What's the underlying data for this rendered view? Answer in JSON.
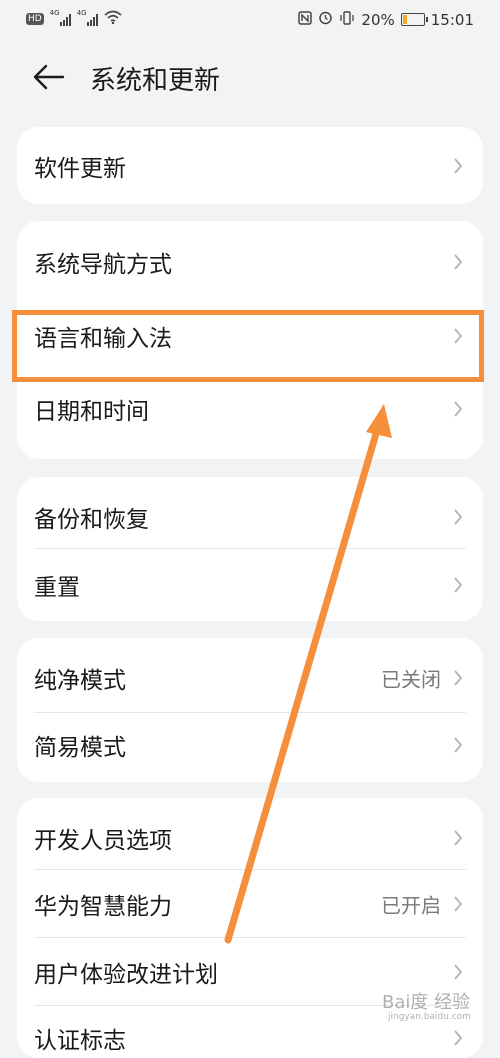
{
  "status_bar": {
    "hd": "HD",
    "sim1_network": "4G",
    "sim2_network": "4G",
    "battery_percent": "20%",
    "battery_level": 0.2,
    "time": "15:01",
    "icons": [
      "nfc-icon",
      "alarm-icon",
      "vibrate-icon",
      "wifi-icon"
    ]
  },
  "header": {
    "title": "系统和更新",
    "back_icon": "back-arrow-icon"
  },
  "sections": [
    {
      "items": [
        {
          "label": "软件更新"
        }
      ]
    },
    {
      "items": [
        {
          "label": "系统导航方式"
        },
        {
          "label": "语言和输入法",
          "highlighted": true
        },
        {
          "label": "日期和时间"
        }
      ]
    },
    {
      "items": [
        {
          "label": "备份和恢复"
        },
        {
          "label": "重置"
        }
      ]
    },
    {
      "items": [
        {
          "label": "纯净模式",
          "value": "已关闭"
        },
        {
          "label": "简易模式"
        }
      ]
    },
    {
      "items": [
        {
          "label": "开发人员选项"
        },
        {
          "label": "华为智慧能力",
          "value": "已开启"
        },
        {
          "label": "用户体验改进计划"
        },
        {
          "label": "认证标志"
        }
      ]
    }
  ],
  "annotation": {
    "highlight_color": "#f58f3c",
    "arrow_color": "#f58f3c"
  },
  "watermark": {
    "logo": "Bai度 经验",
    "sub": "jingyan.baidu.com"
  }
}
